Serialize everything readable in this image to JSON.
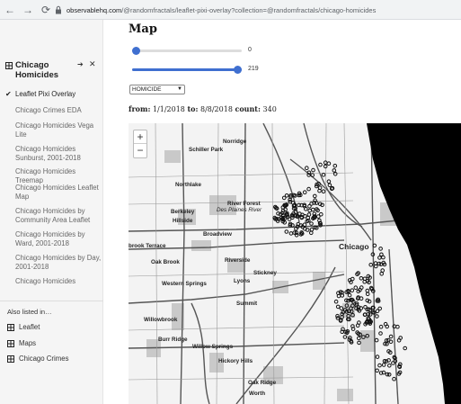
{
  "browser": {
    "url_host": "observablehq.com",
    "url_path": "/@randomfractals/leaflet-pixi-overlay?collection=@randomfractals/chicago-homicides"
  },
  "sidebar": {
    "title": "Chicago Homicides",
    "pin_symbol": "➔",
    "close_symbol": "✕",
    "items": [
      {
        "label": "Leaflet Pixi Overlay",
        "active": true
      },
      {
        "label": "Chicago Crimes EDA"
      },
      {
        "label": "Chicago Homicides Vega Lite"
      },
      {
        "label": "Chicago Homicides Sunburst, 2001-2018"
      },
      {
        "label": "Chicago Homicides Treemap"
      },
      {
        "label": "Chicago Homicides Leaflet Map"
      },
      {
        "label": "Chicago Homicides by Community Area Leaflet"
      },
      {
        "label": "Chicago Homicides by Ward, 2001-2018"
      },
      {
        "label": "Chicago Homicides by Day, 2001-2018"
      },
      {
        "label": "Chicago Homicides"
      }
    ],
    "also_listed": "Also listed in…",
    "collections": [
      {
        "label": "Leaflet"
      },
      {
        "label": "Maps"
      },
      {
        "label": "Chicago Crimes"
      }
    ]
  },
  "main": {
    "title": "Map",
    "slider1": {
      "value": "0",
      "fraction": 0
    },
    "slider2": {
      "value": "219",
      "fraction": 1
    },
    "select_value": "HOMICIDE",
    "stats": {
      "from_label": "from:",
      "from_value": "1/1/2018",
      "to_label": "to:",
      "to_value": "8/8/2018",
      "count_label": "count:",
      "count_value": "340"
    },
    "zoom_in": "+",
    "zoom_out": "−",
    "map_labels": [
      "Norridge",
      "Schiller Park",
      "Northlake",
      "River Forest",
      "Des Plaines River",
      "Berkeley",
      "Hillside",
      "Broadview",
      "Chicago",
      "brook Terrace",
      "Oak Brook",
      "Riverside",
      "Stickney",
      "Western Springs",
      "Lyons",
      "Summit",
      "Willowbrook",
      "Burr Ridge",
      "Willow Springs",
      "Hickory Hills",
      "Oak Ridge",
      "Worth"
    ]
  },
  "colors": {
    "accent": "#3f6fd0",
    "lake": "#000000",
    "points": "#000000"
  }
}
